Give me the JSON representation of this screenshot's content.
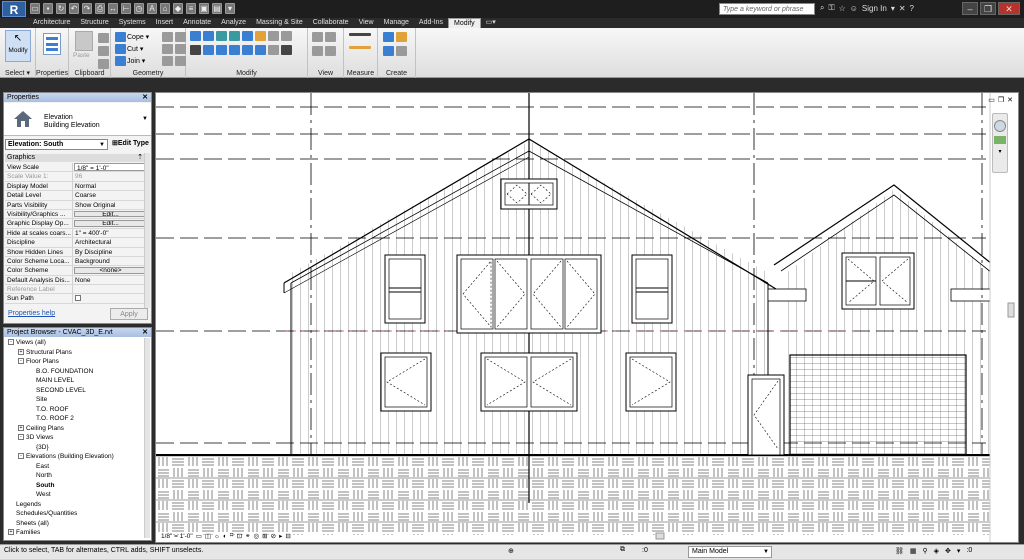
{
  "app": {
    "logo": "R",
    "search_placeholder": "Type a keyword or phrase",
    "sign_in": "Sign In"
  },
  "tabs": [
    "Architecture",
    "Structure",
    "Systems",
    "Insert",
    "Annotate",
    "Analyze",
    "Massing & Site",
    "Collaborate",
    "View",
    "Manage",
    "Add-Ins",
    "Modify"
  ],
  "ribbon": {
    "modify_label": "Modify",
    "panels": {
      "select": "Select",
      "properties": "Properties",
      "clipboard": "Clipboard",
      "geometry": "Geometry",
      "modify": "Modify",
      "view": "View",
      "measure": "Measure",
      "create": "Create"
    },
    "paste": "Paste",
    "cope": "Cope",
    "cut": "Cut",
    "join": "Join"
  },
  "properties": {
    "title": "Properties",
    "type_line1": "Elevation",
    "type_line2": "Building Elevation",
    "instance_selector": "Elevation: South",
    "edit_type": "Edit Type",
    "group": "Graphics",
    "rows": [
      {
        "key": "View Scale",
        "value": "1/8\" = 1'-0\"",
        "kind": "input"
      },
      {
        "key": "Scale Value    1:",
        "value": "96",
        "kind": "grey"
      },
      {
        "key": "Display Model",
        "value": "Normal",
        "kind": "text"
      },
      {
        "key": "Detail Level",
        "value": "Coarse",
        "kind": "text"
      },
      {
        "key": "Parts Visibility",
        "value": "Show Original",
        "kind": "text"
      },
      {
        "key": "Visibility/Graphics ...",
        "value": "Edit...",
        "kind": "btn"
      },
      {
        "key": "Graphic Display Op...",
        "value": "Edit...",
        "kind": "btn"
      },
      {
        "key": "Hide at scales coars...",
        "value": "1\" = 400'-0\"",
        "kind": "text"
      },
      {
        "key": "Discipline",
        "value": "Architectural",
        "kind": "text"
      },
      {
        "key": "Show Hidden Lines",
        "value": "By Discipline",
        "kind": "text"
      },
      {
        "key": "Color Scheme Loca...",
        "value": "Background",
        "kind": "text"
      },
      {
        "key": "Color Scheme",
        "value": "<none>",
        "kind": "btn"
      },
      {
        "key": "Default Analysis Dis...",
        "value": "None",
        "kind": "text"
      },
      {
        "key": "Reference Label",
        "value": "",
        "kind": "grey"
      },
      {
        "key": "Sun Path",
        "value": "",
        "kind": "check"
      }
    ],
    "help": "Properties help",
    "apply": "Apply"
  },
  "browser": {
    "title": "Project Browser - CVAC_3D_E.rvt",
    "items": [
      {
        "label": "Views (all)",
        "depth": 0,
        "tog": "-"
      },
      {
        "label": "Structural Plans",
        "depth": 1,
        "tog": "+"
      },
      {
        "label": "Floor Plans",
        "depth": 1,
        "tog": "-"
      },
      {
        "label": "B.O. FOUNDATION",
        "depth": 2,
        "tog": ""
      },
      {
        "label": "MAIN LEVEL",
        "depth": 2,
        "tog": ""
      },
      {
        "label": "SECOND LEVEL",
        "depth": 2,
        "tog": ""
      },
      {
        "label": "Site",
        "depth": 2,
        "tog": ""
      },
      {
        "label": "T.O. ROOF",
        "depth": 2,
        "tog": ""
      },
      {
        "label": "T.O. ROOF 2",
        "depth": 2,
        "tog": ""
      },
      {
        "label": "Ceiling Plans",
        "depth": 1,
        "tog": "+"
      },
      {
        "label": "3D Views",
        "depth": 1,
        "tog": "-"
      },
      {
        "label": "{3D}",
        "depth": 2,
        "tog": ""
      },
      {
        "label": "Elevations (Building Elevation)",
        "depth": 1,
        "tog": "-"
      },
      {
        "label": "East",
        "depth": 2,
        "tog": ""
      },
      {
        "label": "North",
        "depth": 2,
        "tog": ""
      },
      {
        "label": "South",
        "depth": 2,
        "tog": "",
        "selected": true
      },
      {
        "label": "West",
        "depth": 2,
        "tog": ""
      },
      {
        "label": "Legends",
        "depth": 0,
        "tog": ""
      },
      {
        "label": "Schedules/Quantities",
        "depth": 0,
        "tog": ""
      },
      {
        "label": "Sheets (all)",
        "depth": 0,
        "tog": ""
      },
      {
        "label": "Families",
        "depth": 0,
        "tog": "+"
      }
    ]
  },
  "view": {
    "scale": "1/8\" = 1'-0\""
  },
  "status": {
    "text": "Click to select, TAB for alternates, CTRL adds, SHIFT unselects.",
    "zero": ":0",
    "workset": "Main Model"
  }
}
